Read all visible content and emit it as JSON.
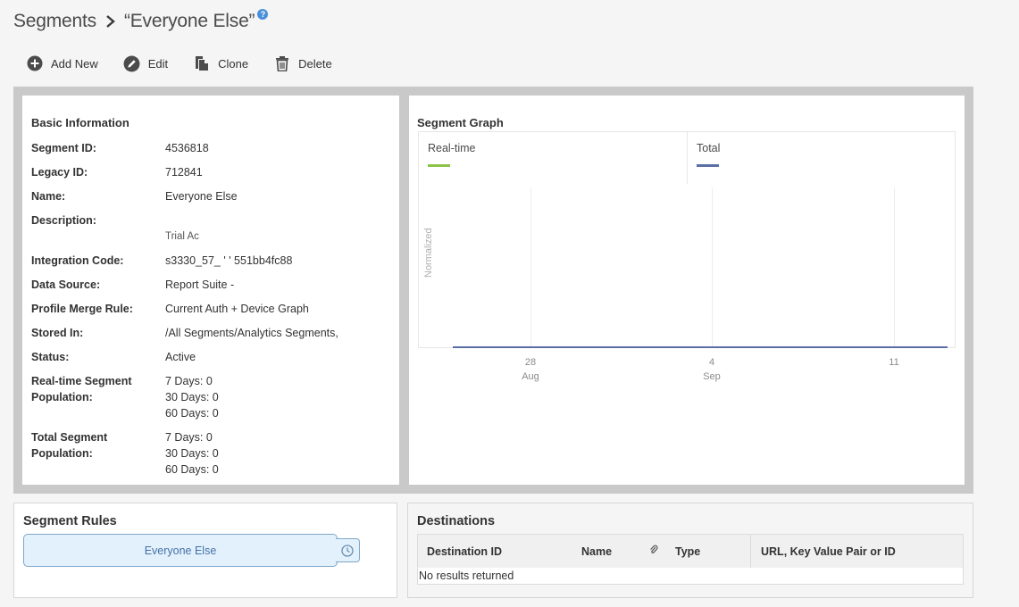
{
  "breadcrumb": {
    "root": "Segments",
    "current": "“Everyone Else”",
    "help": "?"
  },
  "toolbar": {
    "add_new": "Add New",
    "edit": "Edit",
    "clone": "Clone",
    "delete": "Delete"
  },
  "basic_info": {
    "title": "Basic Information",
    "segment_id_label": "Segment ID:",
    "segment_id": "4536818",
    "legacy_id_label": "Legacy ID:",
    "legacy_id": "712841",
    "name_label": "Name:",
    "name": "Everyone Else",
    "description_label": "Description:",
    "description": "Trial Ac",
    "integration_code_label": "Integration Code:",
    "integration_code": "s3330_57_ ' ' 551bb4fc88",
    "data_source_label": "Data Source:",
    "data_source": "Report Suite -",
    "merge_rule_label": "Profile Merge Rule:",
    "merge_rule": "Current Auth + Device Graph",
    "stored_in_label": "Stored In:",
    "stored_in": "/All Segments/Analytics Segments,",
    "status_label": "Status:",
    "status": "Active",
    "realtime_label": "Real-time Segment\nPopulation:",
    "realtime_values": "7 Days: 0\n30 Days: 0\n60 Days: 0",
    "total_label": "Total Segment\nPopulation:",
    "total_values": "7 Days: 0\n30 Days: 0\n60 Days: 0"
  },
  "graph": {
    "title": "Segment Graph",
    "ylabel": "Normalized",
    "legend": {
      "realtime": "Real-time",
      "total": "Total"
    },
    "colors": {
      "realtime": "#8bc34a",
      "total": "#5a6fa5"
    },
    "ticks": [
      {
        "day": "28",
        "month": "Aug"
      },
      {
        "day": "4",
        "month": "Sep"
      },
      {
        "day": "11",
        "month": ""
      }
    ]
  },
  "rules": {
    "title": "Segment Rules",
    "rule": "Everyone Else"
  },
  "destinations": {
    "title": "Destinations",
    "columns": {
      "id": "Destination ID",
      "name": "Name",
      "type": "Type",
      "url": "URL, Key Value Pair or ID"
    },
    "empty": "No results returned"
  }
}
